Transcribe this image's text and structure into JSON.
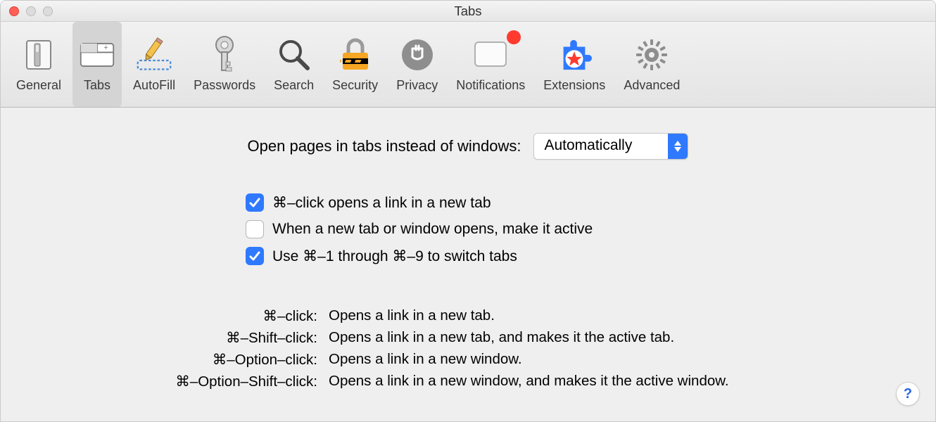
{
  "window": {
    "title": "Tabs"
  },
  "toolbar": {
    "items": [
      {
        "label": "General"
      },
      {
        "label": "Tabs"
      },
      {
        "label": "AutoFill"
      },
      {
        "label": "Passwords"
      },
      {
        "label": "Search"
      },
      {
        "label": "Security"
      },
      {
        "label": "Privacy"
      },
      {
        "label": "Notifications"
      },
      {
        "label": "Extensions"
      },
      {
        "label": "Advanced"
      }
    ]
  },
  "content": {
    "open_label": "Open pages in tabs instead of windows:",
    "open_value": "Automatically",
    "checks": [
      {
        "label": "⌘–click opens a link in a new tab",
        "checked": true
      },
      {
        "label": "When a new tab or window opens, make it active",
        "checked": false
      },
      {
        "label": "Use ⌘–1 through ⌘–9 to switch tabs",
        "checked": true
      }
    ],
    "hints": [
      {
        "key": "⌘–click:",
        "desc": "Opens a link in a new tab."
      },
      {
        "key": "⌘–Shift–click:",
        "desc": "Opens a link in a new tab, and makes it the active tab."
      },
      {
        "key": "⌘–Option–click:",
        "desc": "Opens a link in a new window."
      },
      {
        "key": "⌘–Option–Shift–click:",
        "desc": "Opens a link in a new window, and makes it the active window."
      }
    ],
    "help_glyph": "?"
  }
}
